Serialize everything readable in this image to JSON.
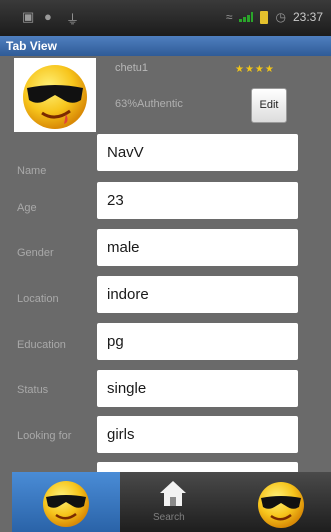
{
  "status_bar": {
    "time": "23:37"
  },
  "app": {
    "title": "Tab View"
  },
  "profile": {
    "name": "chetu1",
    "rating_stars": 4,
    "rating_text": "★★★★",
    "authentic": "63%Authentic",
    "edit_label": "Edit",
    "avatar_icon": "sunglasses-smiley-icon"
  },
  "fields": [
    {
      "label": "Name",
      "value": "NavV"
    },
    {
      "label": "Age",
      "value": "23"
    },
    {
      "label": "Gender",
      "value": "male"
    },
    {
      "label": "Location",
      "value": "indore"
    },
    {
      "label": "Education",
      "value": "pg"
    },
    {
      "label": "Status",
      "value": "single"
    },
    {
      "label": "Looking for",
      "value": "girls"
    }
  ],
  "tabs": [
    {
      "icon": "sunglasses-smiley-icon",
      "label": "",
      "selected": true
    },
    {
      "icon": "home-icon",
      "label": "Search",
      "selected": false
    },
    {
      "icon": "sunglasses-smiley-icon",
      "label": "",
      "selected": false
    }
  ],
  "colors": {
    "title_bar": "#3f6fb0",
    "selected_tab": "#3a7ac5",
    "background": "#6a6a6a",
    "star": "#f0c419"
  }
}
